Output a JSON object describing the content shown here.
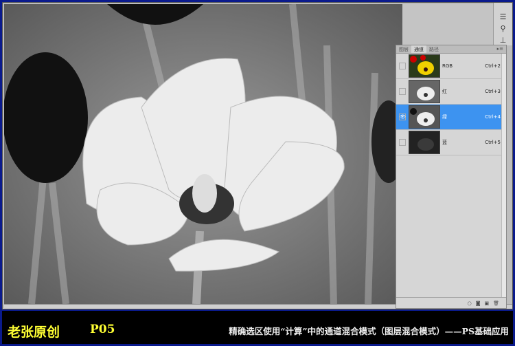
{
  "panel": {
    "tabs": [
      "图层",
      "通道",
      "路径"
    ],
    "active_tab": 1,
    "channels": [
      {
        "name": "RGB",
        "shortcut": "Ctrl+2",
        "visible": false,
        "selected": false
      },
      {
        "name": "红",
        "shortcut": "Ctrl+3",
        "visible": false,
        "selected": false
      },
      {
        "name": "绿",
        "shortcut": "Ctrl+4",
        "visible": true,
        "selected": true
      },
      {
        "name": "蓝",
        "shortcut": "Ctrl+5",
        "visible": false,
        "selected": false
      }
    ]
  },
  "caption": {
    "author": "老张原创",
    "page": "P05",
    "title": "精确选区使用“计算”中的通道混合模式（图层混合模式）——PS基础应用"
  },
  "colors": {
    "selection": "#3d93f0",
    "caption_yellow": "#ffff33",
    "border": "#0a1a8c"
  }
}
